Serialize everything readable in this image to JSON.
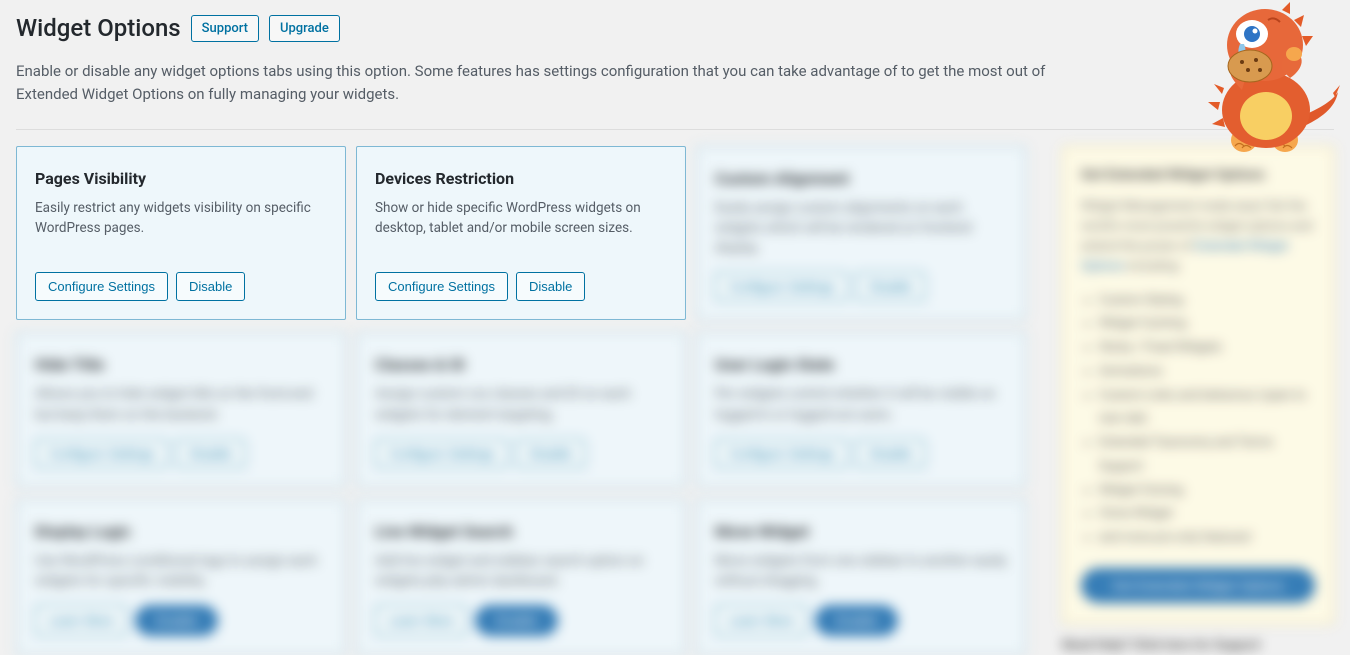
{
  "header": {
    "title": "Widget Options",
    "support_label": "Support",
    "upgrade_label": "Upgrade",
    "intro": "Enable or disable any widget options tabs using this option. Some features has settings configuration that you can take advantage of to get the most out of Extended Widget Options on fully managing your widgets."
  },
  "cards": [
    {
      "title": "Pages Visibility",
      "desc": "Easily restrict any widgets visibility on specific WordPress pages.",
      "primary": "Configure Settings",
      "secondary": "Disable",
      "blurred": false
    },
    {
      "title": "Devices Restriction",
      "desc": "Show or hide specific WordPress widgets on desktop, tablet and/or mobile screen sizes.",
      "primary": "Configure Settings",
      "secondary": "Disable",
      "blurred": false
    },
    {
      "title": "Custom Alignment",
      "desc": "Easily assign custom alignments on each widgets which will be rendered on frontend display.",
      "primary": "Configure Settings",
      "secondary": "Disable",
      "blurred": true
    },
    {
      "title": "Hide Title",
      "desc": "Allows you to hide widget title on the front-end but keep them on the backend.",
      "primary": "Configure Settings",
      "secondary": "Disable",
      "blurred": true
    },
    {
      "title": "Classes & ID",
      "desc": "Assign custom css classes and ID on each widgets for element targeting.",
      "primary": "Configure Settings",
      "secondary": "Disable",
      "blurred": true
    },
    {
      "title": "User Login State",
      "desc": "Per widgets control whether it will be visible on logged-in or logged-out users.",
      "primary": "Configure Settings",
      "secondary": "Disable",
      "blurred": true
    },
    {
      "title": "Display Logic",
      "desc": "Use WordPress conditional tags to assign each widgets for specific visibility.",
      "primary": "Learn More",
      "secondary": "Enable",
      "solid": true,
      "blurred": true
    },
    {
      "title": "Live Widget Search",
      "desc": "Add live widget and sidebar search option on widgets.php admin dashboard.",
      "primary": "Learn More",
      "secondary": "Enable",
      "solid": true,
      "blurred": true
    },
    {
      "title": "Move Widget",
      "desc": "Move widgets from one sidebar to another easily without dragging.",
      "primary": "Learn More",
      "secondary": "Enable",
      "solid": true,
      "blurred": true
    }
  ],
  "sidebar": {
    "title": "Get Extended Widget Options",
    "para_a": "Widget Management made easy! Get the world's most powerful widget options and extend the power of",
    "link": "Extended Widget Options",
    "para_b": "including:",
    "features": [
      "Custom Styling",
      "Widget Caching",
      "Sticky / Fixed Widgets",
      "Animations",
      "Custom Links and behaviour (open to new tab)",
      "Extended Taxonomy and Terms Support",
      "Widget Cloning",
      "Clone Widget",
      "and more pro-only features!"
    ],
    "cta": "Get Extended Widget Options",
    "footer": "Need Help? Click here for Support"
  }
}
